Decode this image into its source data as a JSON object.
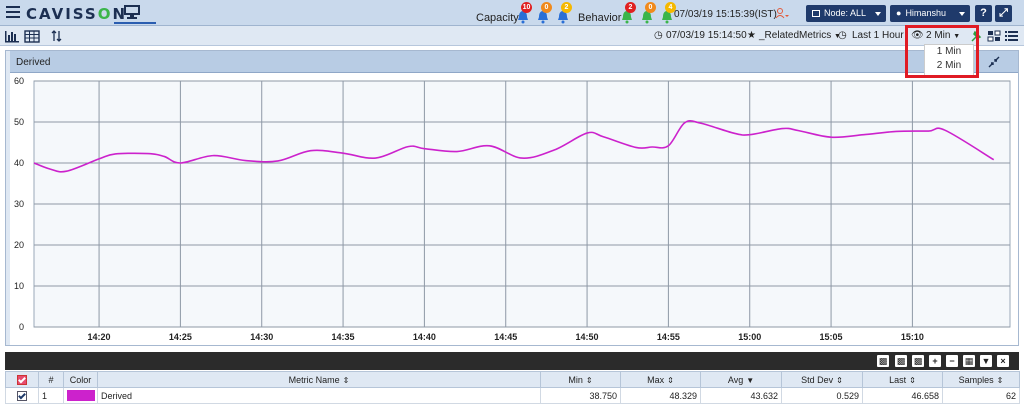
{
  "header": {
    "logo_text_a": "CAVISS",
    "logo_text_o": "O",
    "logo_text_b": "N",
    "capacity_label": "Capacity",
    "behavior_label": "Behavior",
    "capacity_badges": [
      {
        "count": "10",
        "color": "#e02020"
      },
      {
        "count": "0",
        "color": "#f08a1c"
      },
      {
        "count": "2",
        "color": "#f5b800"
      }
    ],
    "behavior_badges": [
      {
        "count": "2",
        "color": "#e02020"
      },
      {
        "count": "0",
        "color": "#f08a1c"
      },
      {
        "count": "4",
        "color": "#f5b800"
      }
    ],
    "datetime": "07/03/19 15:15:39(IST)",
    "node_label": "Node: ALL",
    "user_label": "Himanshu",
    "help_label": "?",
    "expand_label": "⤢"
  },
  "toolbar": {
    "time": "07/03/19 15:14:50",
    "favorite": "_RelatedMetrics",
    "range": "Last 1 Hour",
    "interval": "2 Min"
  },
  "dropdown": {
    "options": [
      "1 Min",
      "2 Min"
    ]
  },
  "panel": {
    "title": "Derived"
  },
  "chart_data": {
    "type": "line",
    "title": "",
    "xlabel": "",
    "ylabel": "",
    "ylim": [
      0,
      60
    ],
    "yticks": [
      0,
      10,
      20,
      30,
      40,
      50,
      60
    ],
    "xlim": [
      "14:16",
      "15:16"
    ],
    "xticks": [
      "14:20",
      "14:25",
      "14:30",
      "14:35",
      "14:40",
      "14:45",
      "14:50",
      "14:55",
      "15:00",
      "15:05",
      "15:10"
    ],
    "series": [
      {
        "color": "#cc22cc",
        "x": [
          "14:16",
          "14:17",
          "14:18",
          "14:20",
          "14:21",
          "14:23",
          "14:24",
          "14:25",
          "14:27",
          "14:29",
          "14:31",
          "14:33",
          "14:35",
          "14:37",
          "14:39",
          "14:40",
          "14:42",
          "14:44",
          "14:46",
          "14:48",
          "14:50",
          "14:51",
          "14:53",
          "14:54",
          "14:55",
          "14:56",
          "14:57",
          "14:59",
          "15:00",
          "15:02",
          "15:03",
          "15:05",
          "15:07",
          "15:09",
          "15:11",
          "15:12",
          "15:15"
        ],
        "y": [
          40,
          38.5,
          38,
          41,
          42.2,
          42.3,
          41.6,
          40,
          41.8,
          40.6,
          40.5,
          43,
          42.4,
          41.2,
          44,
          43.5,
          42.8,
          44.2,
          41.2,
          43.2,
          47.3,
          46.4,
          43.8,
          43.9,
          44.2,
          49.8,
          49.7,
          47.3,
          46.9,
          48.4,
          47.9,
          46.3,
          46.9,
          47.7,
          47.8,
          48,
          40.8
        ]
      }
    ]
  },
  "table": {
    "columns": [
      "#",
      "Color",
      "Metric Name",
      "Min",
      "Max",
      "Avg",
      "Std Dev",
      "Last",
      "Samples"
    ],
    "rows": [
      {
        "num": "1",
        "color": "#cc22cc",
        "name": "Derived",
        "min": "38.750",
        "max": "48.329",
        "avg": "43.632",
        "std": "0.529",
        "last": "46.658",
        "samples": "62"
      }
    ]
  }
}
